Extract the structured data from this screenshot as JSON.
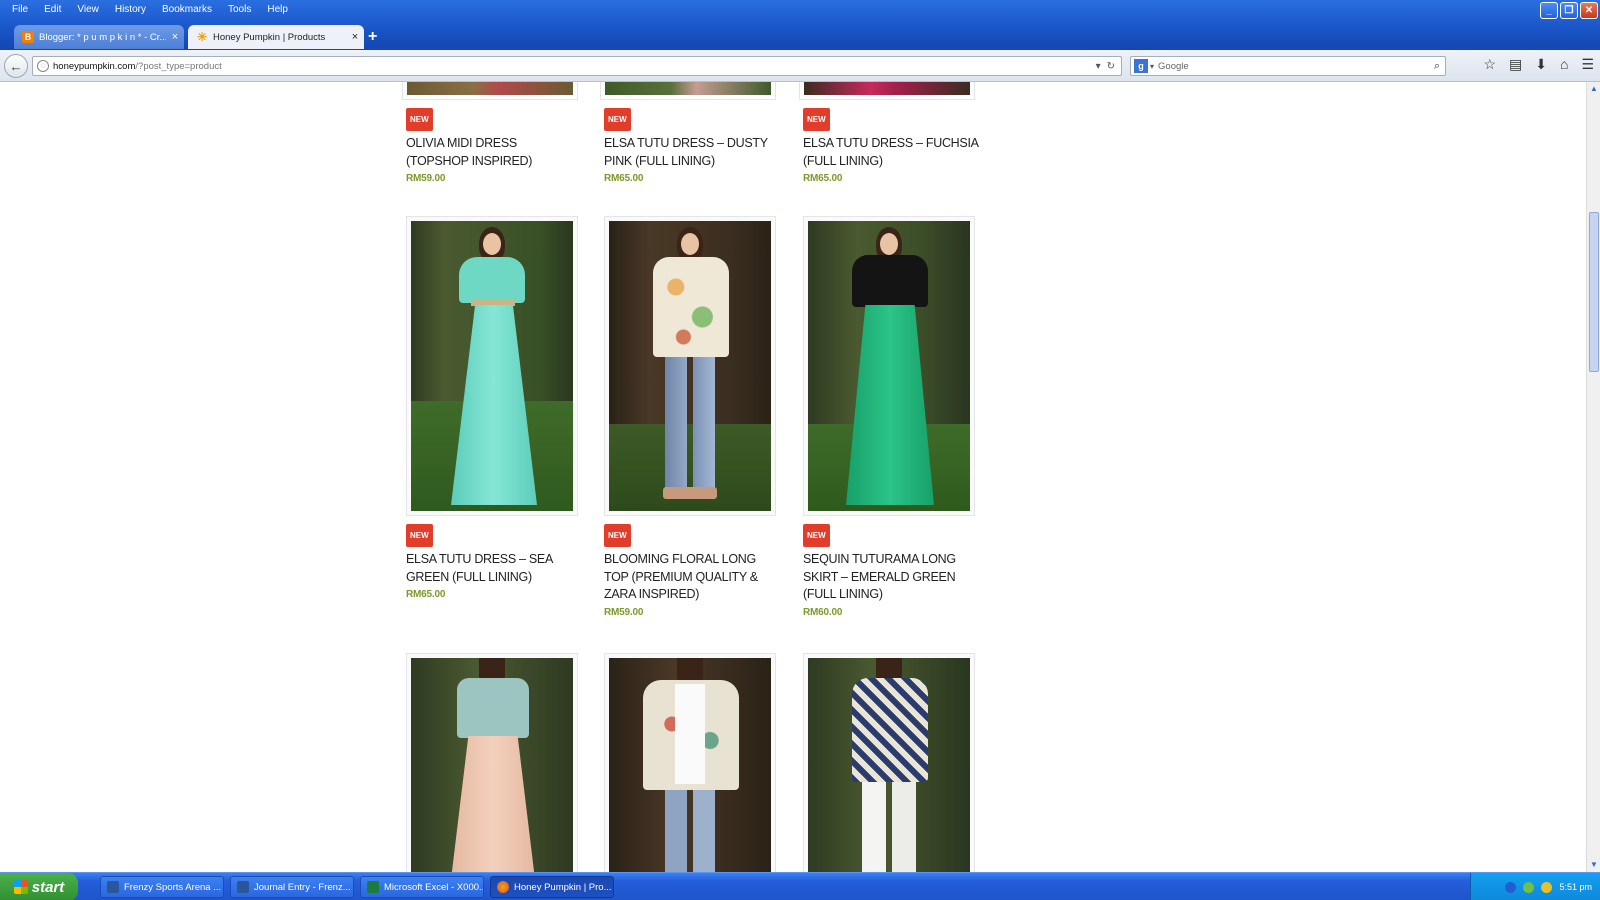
{
  "menubar": [
    "File",
    "Edit",
    "View",
    "History",
    "Bookmarks",
    "Tools",
    "Help"
  ],
  "tabs": [
    {
      "title": "Blogger: * p u m p k i n * - Cr...",
      "close": "×"
    },
    {
      "title": "Honey Pumpkin | Products",
      "close": "×"
    }
  ],
  "new_tab": "+",
  "address": {
    "host": "honeypumpkin.com",
    "path": "/?post_type=product"
  },
  "search": {
    "placeholder": "Google"
  },
  "icons": {
    "back": "back-arrow-icon",
    "bookmark": "star-icon",
    "reader": "clipboard-icon",
    "download": "download-icon",
    "home": "home-icon",
    "menu": "hamburger-menu-icon"
  },
  "products": [
    {
      "badge": "NEW",
      "title": "OLIVIA MIDI DRESS (TOPSHOP INSPIRED)",
      "price": "RM59.00"
    },
    {
      "badge": "NEW",
      "title": "ELSA TUTU DRESS – DUSTY PINK (FULL LINING)",
      "price": "RM65.00"
    },
    {
      "badge": "NEW",
      "title": "ELSA TUTU DRESS – FUCHSIA (FULL LINING)",
      "price": "RM65.00"
    },
    {
      "badge": "NEW",
      "title": "ELSA TUTU DRESS – SEA GREEN (FULL LINING)",
      "price": "RM65.00"
    },
    {
      "badge": "NEW",
      "title": "BLOOMING FLORAL LONG TOP (PREMIUM QUALITY & ZARA INSPIRED)",
      "price": "RM59.00"
    },
    {
      "badge": "NEW",
      "title": "SEQUIN TUTURAMA LONG SKIRT – EMERALD GREEN (FULL LINING)",
      "price": "RM60.00"
    }
  ],
  "taskbar": {
    "start": "start",
    "tasks": [
      "Frenzy Sports Arena ...",
      "Journal Entry - Frenz...",
      "Microsoft Excel - X000...",
      "Honey Pumpkin | Pro..."
    ],
    "clock": "5:51 pm"
  }
}
